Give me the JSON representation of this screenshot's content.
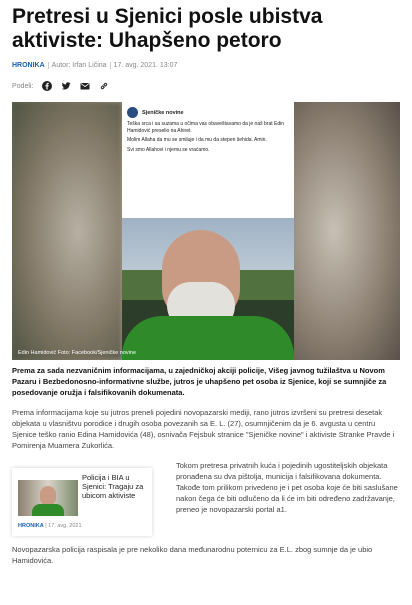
{
  "article": {
    "title": "Pretresi u Sjenici posle ubistva aktiviste: Uhapšeno petoro",
    "category": "HRONIKA",
    "author": "Autor: Irfan Ličina",
    "date": "17. avg. 2021. 13:07",
    "share_label": "Podeli:",
    "lead": "Prema za sada nezvaničnim informacijama, u zajedničkoj akciji policije, Višeg javnog tužilaštva u Novom Pazaru i Bezbedonosno-informativne službe, jutros je uhapšeno pet osoba iz Sjenice, koji se sumnjiče za posedovanje oružja i falsifikovanih dokumenata.",
    "paragraph1": "Prema informacijama koje su jutros preneli pojedini novopazarski mediji, rano jutros izvršeni su pretresi desetak objekata u vlasništvu porodice i drugih osoba povezanih sa E. L. (27), osumnjičenim da je 6. avgusta u centru Sjenice teško ranio Edina Hamidovića (48), osnivača Fejsbuk stranice \"Sjeničke novine\" i aktiviste Stranke Pravde i Pomirenja Muamera Zukorlića.",
    "paragraph2": "Tokom pretresa privatnih kuća i pojedinih ugostiteljskih objekata pronađena su dva pištolja, municija i falsifikovana dokumenta. Takođe tom prilikom privedeno je i pet osoba koje će biti saslušane nakon čega će biti odlučeno da li će im biti određeno zadržavanje, preneo je novopazarski portal a1.",
    "paragraph3": "Novopazarska policija raspisala je pre nekoliko dana međunarodnu poternicu za E.L. zbog sumnje da je ubio Hamidovića."
  },
  "hero": {
    "caption": "Edin Hamidović Foto: Facebook/Sjeničke novine",
    "post_page": "Sjeničke novine",
    "post_line1": "Teška srca i sa suzama u očima vas obaveštavamo da je naš brat Edin Hamidović preselio na Ahiret.",
    "post_line2": "Molim Allaha da mu se smiluje i da mu da stepen šehida. Amin.",
    "post_line3": "Svi smo Allahovi i njemu se vraćamo."
  },
  "related": {
    "title": "Policija i BIA u Sjenici: Tragaju za ubicom aktiviste",
    "category": "HRONIKA",
    "date": "17. avg. 2021"
  },
  "icons": [
    "facebook-icon",
    "twitter-icon",
    "email-icon",
    "link-icon"
  ],
  "colors": {
    "accent": "#1a5fb4",
    "text": "#222222",
    "meta": "#888888"
  }
}
